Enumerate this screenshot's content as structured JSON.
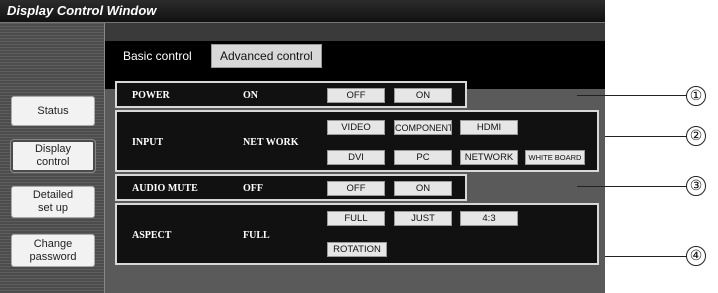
{
  "window": {
    "title": "Display Control Window"
  },
  "sidebar": {
    "items": [
      {
        "label": "Status",
        "active": false
      },
      {
        "label": "Display\ncontrol",
        "active": true
      },
      {
        "label": "Detailed\nset up",
        "active": false
      },
      {
        "label": "Change\npassword",
        "active": false
      }
    ]
  },
  "tabs": [
    {
      "label": "Basic control",
      "active": true
    },
    {
      "label": "Advanced control",
      "active": false
    }
  ],
  "panels": {
    "power": {
      "label": "POWER",
      "value": "ON",
      "buttons": [
        "OFF",
        "ON"
      ]
    },
    "input": {
      "label": "INPUT",
      "value": "NET WORK",
      "buttons": [
        "VIDEO",
        "COMPONENT",
        "HDMI",
        "DVI",
        "PC",
        "NETWORK",
        "WHITE BOARD"
      ]
    },
    "audio_mute": {
      "label": "AUDIO MUTE",
      "value": "OFF",
      "buttons": [
        "OFF",
        "ON"
      ]
    },
    "aspect": {
      "label": "ASPECT",
      "value": "FULL",
      "buttons": [
        "FULL",
        "JUST",
        "4:3",
        "ROTATION"
      ]
    }
  },
  "callouts": [
    "①",
    "②",
    "③",
    "④"
  ],
  "colors": {
    "panel_border": "#d8d8d8",
    "button_bg": "#e6e6e6",
    "window_bg": "#585858"
  }
}
